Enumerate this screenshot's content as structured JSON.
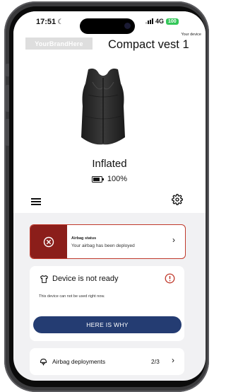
{
  "status_bar": {
    "time": "17:51",
    "network": "4G",
    "battery": "100"
  },
  "header": {
    "brand": "YourBrandHere",
    "device_caption": "Your device",
    "device_name": "Compact vest 1"
  },
  "device": {
    "state": "Inflated",
    "battery_level": "100%"
  },
  "alert": {
    "title": "Airbag status",
    "message": "Your airbag has been deployed"
  },
  "readiness": {
    "title": "Device is not ready",
    "description": "This device can not be used right now.",
    "button_label": "HERE IS WHY"
  },
  "deployments": {
    "label": "Airbag deployments",
    "count": "2/3"
  },
  "colors": {
    "alert_red": "#8b1e1a",
    "alert_border": "#c0392b",
    "primary_button": "#243c72",
    "battery_green": "#34c759"
  }
}
